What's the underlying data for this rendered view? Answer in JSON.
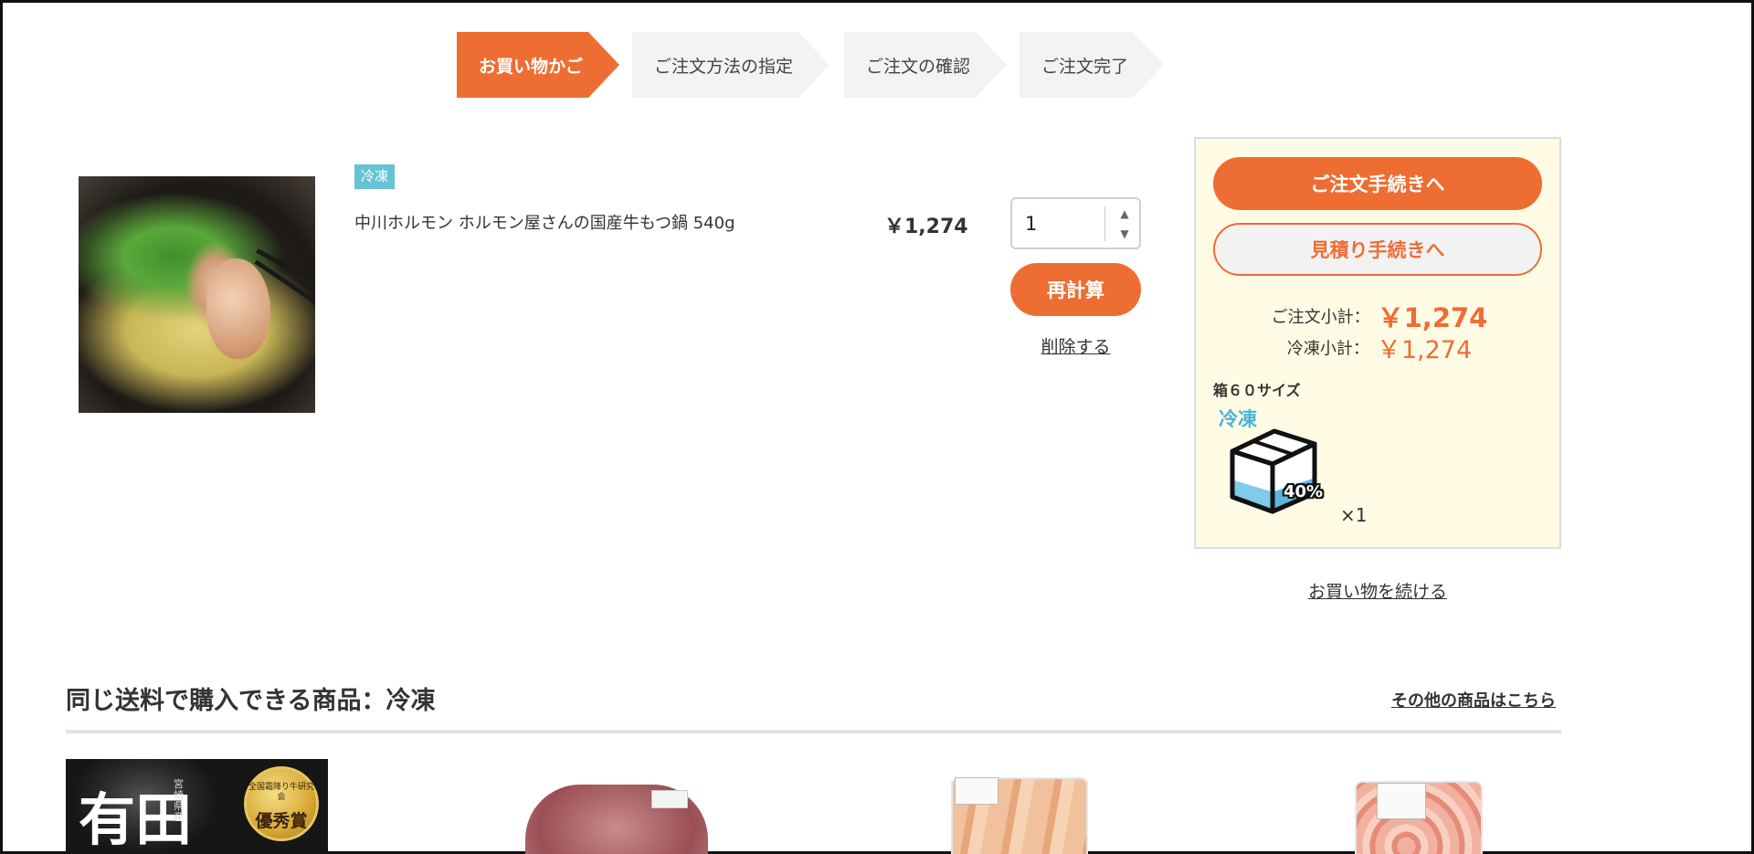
{
  "steps": [
    {
      "label": "お買い物かご",
      "active": true
    },
    {
      "label": "ご注文方法の指定",
      "active": false
    },
    {
      "label": "ご注文の確認",
      "active": false
    },
    {
      "label": "ご注文完了",
      "active": false
    }
  ],
  "cart": {
    "item": {
      "badge": "冷凍",
      "name": "中川ホルモン ホルモン屋さんの国産牛もつ鍋 540g",
      "price": "￥1,274",
      "quantity": "1"
    },
    "recalc_label": "再計算",
    "delete_label": "削除する"
  },
  "summary": {
    "order_button": "ご注文手続きへ",
    "quote_button": "見積り手続きへ",
    "subtotal_label": "ご注文小計：",
    "subtotal_value": "￥1,274",
    "frozen_subtotal_label": "冷凍小計：",
    "frozen_subtotal_value": "￥1,274",
    "box_size": "箱６０サイズ",
    "box_type": "冷凍",
    "box_fill_percent": "40%",
    "box_count": "×1",
    "box_icon": "box-icon",
    "accent_color": "#ee6d33",
    "panel_color": "#fffbe5",
    "frozen_color": "#4ab3d9"
  },
  "continue_shopping": "お買い物を続ける",
  "related": {
    "title": "同じ送料で購入できる商品：冷凍",
    "more_link": "その他の商品はこちら",
    "products": [
      {
        "image_text": "有田",
        "vertical_text": "宮崎県産",
        "medal_top": "全国霜降り牛研究会",
        "medal_main": "優秀賞"
      },
      {
        "image_text": ""
      },
      {
        "image_text": ""
      },
      {
        "image_text": ""
      }
    ]
  }
}
